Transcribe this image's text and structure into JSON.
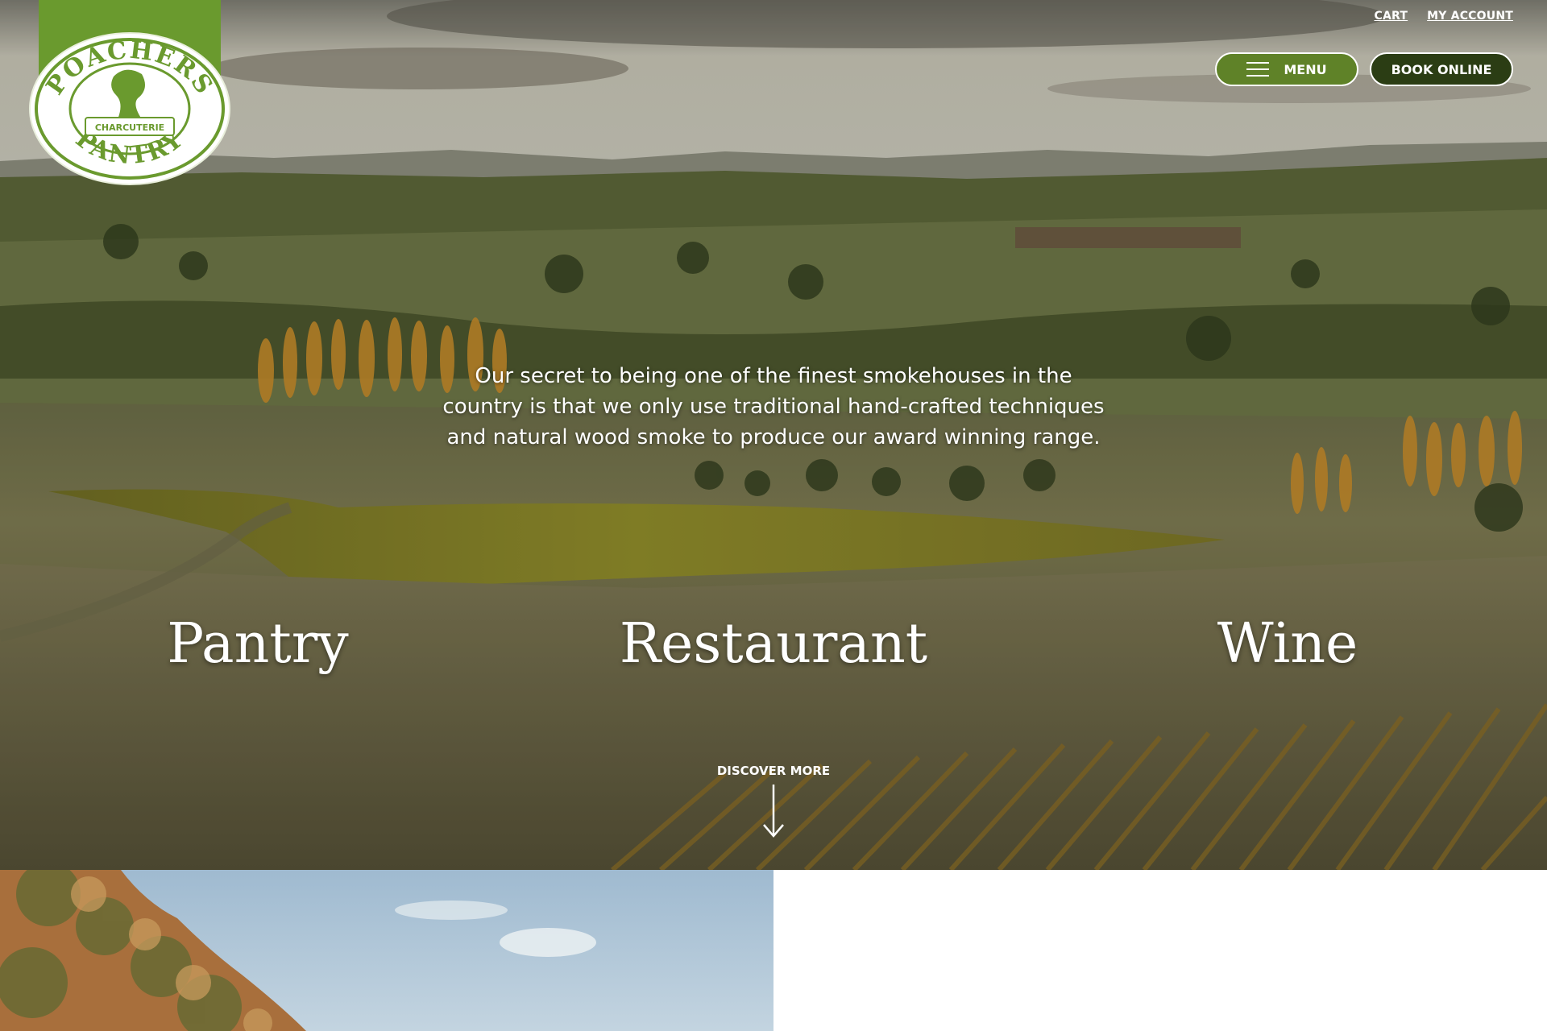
{
  "header": {
    "top_links": {
      "cart": "CART",
      "account": "MY ACCOUNT"
    },
    "menu_label": "MENU",
    "book_label": "BOOK ONLINE",
    "logo_text_top": "POACHERS",
    "logo_text_bottom": "PANTRY",
    "logo_ribbon": "CHARCUTERIE"
  },
  "hero": {
    "tagline_lines": [
      "Our secret to being one of the finest smokehouses in the",
      "country is that we only use traditional hand-crafted techniques",
      "and natural wood smoke to produce our award winning range."
    ],
    "sections": {
      "pantry": "Pantry",
      "restaurant": "Restaurant",
      "wine": "Wine"
    },
    "discover_label": "DISCOVER MORE"
  },
  "colors": {
    "brand_green": "#5f8228",
    "dark_green": "#2b3d14",
    "logo_green": "#6a9a2e",
    "white": "#ffffff"
  },
  "icons": {
    "menu": "hamburger-icon",
    "discover": "arrow-down-icon"
  }
}
